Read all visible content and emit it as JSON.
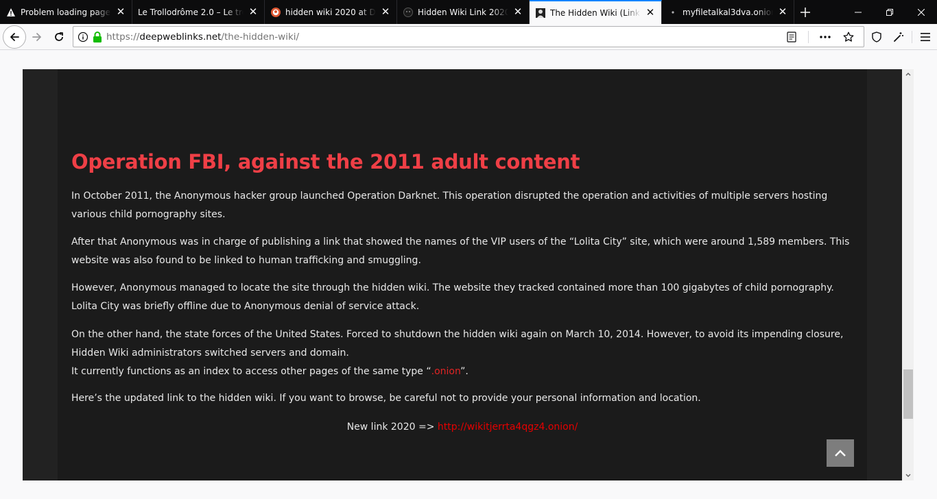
{
  "tabs": [
    {
      "title": "Problem loading page",
      "icon": "warning-icon",
      "active": false
    },
    {
      "title": "Le Trollodrôme 2.0 – Le trollodrôme",
      "icon": "",
      "active": false
    },
    {
      "title": "hidden wiki 2020 at DuckDuckGo",
      "icon": "duckduckgo-icon",
      "active": false
    },
    {
      "title": "Hidden Wiki Link 2020 - Hidden",
      "icon": "mask-icon",
      "active": false
    },
    {
      "title": "The Hidden Wiki (Link 2020)",
      "icon": "site-logo-icon",
      "active": true
    },
    {
      "title": "myfiletalkal3dva.onion/",
      "icon": "dot-icon",
      "active": false
    }
  ],
  "navbar": {
    "url_prefix": "https://",
    "url_host": "deepweblinks.net",
    "url_path": "/the-hidden-wiki/"
  },
  "article": {
    "heading": "Operation FBI, against the 2011 adult content",
    "p1": "In October 2011, the Anonymous hacker group launched Operation Darknet. This operation disrupted the operation and activities of multiple servers hosting various child pornography sites.",
    "p2": "After that Anonymous was in charge of publishing a link that showed the names of the VIP users of the “Lolita City” site, which were around 1,589 members. This website was also found to be linked to human trafficking and smuggling.",
    "p3": "However, Anonymous managed to locate the site through the hidden wiki. The website they tracked contained more than 100 gigabytes of child pornography. Lolita City was briefly offline due to Anonymous denial of service attack.",
    "p4": "On the other hand, the state forces of the United States. Forced to shutdown the hidden wiki again on March 10, 2014. However, to avoid its impending closure, Hidden Wiki administrators switched servers and domain.",
    "p4b_before": "It currently functions as an index to access other pages of the same type “",
    "p4b_link": ".onion",
    "p4b_after": "”.",
    "p5": "Here’s the updated link to the hidden wiki. If you want to browse, be careful not to provide your personal information and location.",
    "newlink_label": "New link 2020 => ",
    "newlink_url": "http://wikitjerrta4qgz4.onion/"
  },
  "colors": {
    "heading": "#ef3f46",
    "link": "#e60000",
    "article_bg": "#1b1b1b",
    "frame_bg": "#222222"
  }
}
